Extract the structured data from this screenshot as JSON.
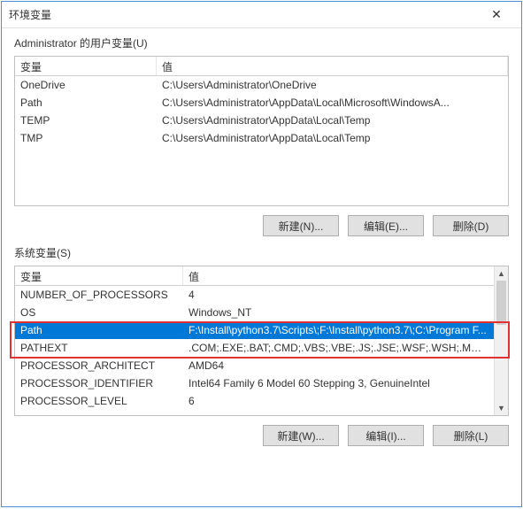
{
  "window": {
    "title": "环境变量"
  },
  "userVars": {
    "label": "Administrator 的用户变量(U)",
    "columns": {
      "name": "变量",
      "value": "值"
    },
    "rows": [
      {
        "name": "OneDrive",
        "value": "C:\\Users\\Administrator\\OneDrive"
      },
      {
        "name": "Path",
        "value": "C:\\Users\\Administrator\\AppData\\Local\\Microsoft\\WindowsA..."
      },
      {
        "name": "TEMP",
        "value": "C:\\Users\\Administrator\\AppData\\Local\\Temp"
      },
      {
        "name": "TMP",
        "value": "C:\\Users\\Administrator\\AppData\\Local\\Temp"
      }
    ],
    "buttons": {
      "new": "新建(N)...",
      "edit": "编辑(E)...",
      "delete": "删除(D)"
    }
  },
  "systemVars": {
    "label": "系统变量(S)",
    "columns": {
      "name": "变量",
      "value": "值"
    },
    "rows": [
      {
        "name": "NUMBER_OF_PROCESSORS",
        "value": "4"
      },
      {
        "name": "OS",
        "value": "Windows_NT"
      },
      {
        "name": "Path",
        "value": "F:\\Install\\python3.7\\Scripts\\;F:\\Install\\python3.7\\;C:\\Program F..."
      },
      {
        "name": "PATHEXT",
        "value": ".COM;.EXE;.BAT;.CMD;.VBS;.VBE;.JS;.JSE;.WSF;.WSH;.MSC;.PY;.P..."
      },
      {
        "name": "PROCESSOR_ARCHITECT",
        "value": "AMD64"
      },
      {
        "name": "PROCESSOR_IDENTIFIER",
        "value": "Intel64 Family 6 Model 60 Stepping 3, GenuineIntel"
      },
      {
        "name": "PROCESSOR_LEVEL",
        "value": "6"
      }
    ],
    "selectedIndex": 2,
    "buttons": {
      "new": "新建(W)...",
      "edit": "编辑(I)...",
      "delete": "删除(L)"
    }
  }
}
